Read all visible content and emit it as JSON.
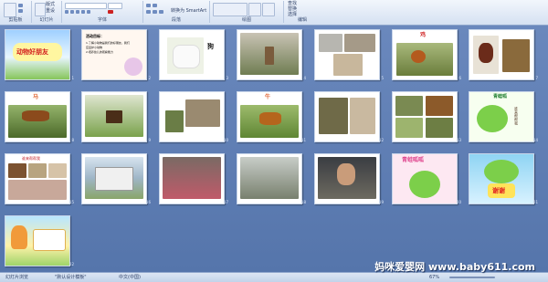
{
  "ribbon": {
    "groups": [
      {
        "label": "剪贴板"
      },
      {
        "label": "幻灯片"
      },
      {
        "label": "字体"
      },
      {
        "label": "段落"
      },
      {
        "label": "绘图"
      },
      {
        "label": "编辑"
      }
    ],
    "font_options": {
      "size_left": "版式",
      "size_right": "重设"
    },
    "convert_label": "转换为 SmartArt",
    "find_label": "查找",
    "replace_label": "替换",
    "select_label": "选择"
  },
  "slides": {
    "s1": {
      "num": "1",
      "title": "动物好朋友"
    },
    "s2": {
      "num": "2",
      "title": "活动目标：",
      "lines": [
        "1.了解小动物是我们的好朋友，我们",
        "应爱护小动物",
        "2.培养幼儿的观察能力"
      ]
    },
    "s3": {
      "num": "3",
      "label": "狗"
    },
    "s4": {
      "num": "4"
    },
    "s5": {
      "num": "5"
    },
    "s6": {
      "num": "6",
      "label": "鸡"
    },
    "s7": {
      "num": "7"
    },
    "s8": {
      "num": "8",
      "label": "马"
    },
    "s9": {
      "num": "9"
    },
    "s10": {
      "num": "10"
    },
    "s11": {
      "num": "11",
      "label": "牛"
    },
    "s12": {
      "num": "12"
    },
    "s13": {
      "num": "13"
    },
    "s14": {
      "num": "14",
      "title": "青蛙呱",
      "side": "谁来帮帮我"
    },
    "s15": {
      "num": "15",
      "title": "谁来帮帮我"
    },
    "s16": {
      "num": "16"
    },
    "s17": {
      "num": "17"
    },
    "s18": {
      "num": "18"
    },
    "s19": {
      "num": "19"
    },
    "s20": {
      "num": "20",
      "title": "青蛙呱呱"
    },
    "s21": {
      "num": "21",
      "title": "谢谢"
    },
    "s22": {
      "num": "22"
    }
  },
  "status": {
    "slide_sorter": "幻灯片浏览",
    "theme": "\"默认设计模板\"",
    "language": "中文(中国)",
    "zoom": "67%"
  },
  "watermark": "妈咪爱婴网  www.baby611.com"
}
